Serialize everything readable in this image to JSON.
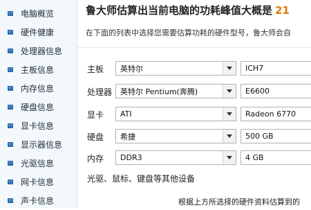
{
  "sidebar": {
    "items": [
      {
        "label": "电脑概览"
      },
      {
        "label": "硬件健康"
      },
      {
        "label": "处理器信息"
      },
      {
        "label": "主板信息"
      },
      {
        "label": "内存信息"
      },
      {
        "label": "硬盘信息"
      },
      {
        "label": "显卡信息"
      },
      {
        "label": "显示器信息"
      },
      {
        "label": "光驱信息"
      },
      {
        "label": "网卡信息"
      },
      {
        "label": "声卡信息"
      }
    ]
  },
  "main": {
    "heading": "鲁大师估算出当前电脑的功耗峰值大概是",
    "heading_number": "21",
    "subtitle": "在下面的列表中选择您需要估算功耗的硬件型号，鲁大师会自",
    "rows": [
      {
        "label": "主板",
        "brand": "英特尔",
        "model": "ICH7"
      },
      {
        "label": "处理器",
        "brand": "英特尔 Pentium(奔腾)",
        "model": "E6600"
      },
      {
        "label": "显卡",
        "brand": "ATI",
        "model": "Radeon 6770"
      },
      {
        "label": "硬盘",
        "brand": "希捷",
        "model": "500 GB"
      },
      {
        "label": "内存",
        "brand": "DDR3",
        "model": "4 GB"
      }
    ],
    "other_devices": "光驱、鼠标、键盘等其他设备",
    "footer": "根据上方所选择的硬件资料估算到的"
  },
  "colors": {
    "accent_number": "#e07a00",
    "sidebar_bg": "#f3f8fc",
    "bullet": "#2e6db4"
  }
}
